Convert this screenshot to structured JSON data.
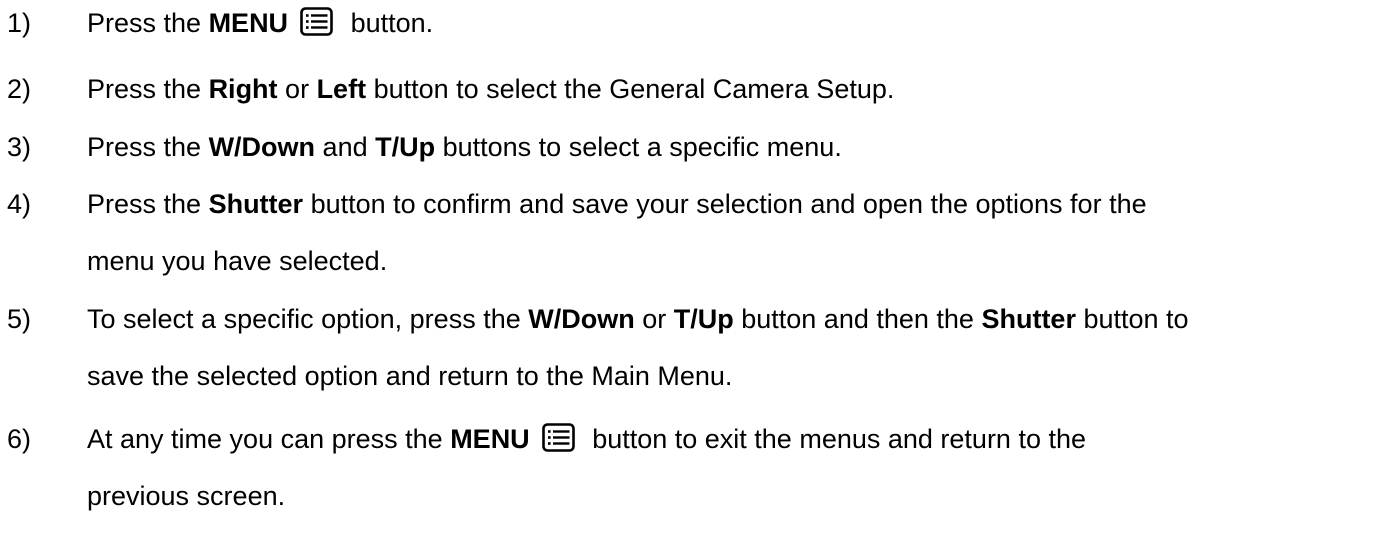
{
  "steps": [
    {
      "num": "1)",
      "parts": {
        "a": "Press the ",
        "b": "MENU",
        "c": " button."
      }
    },
    {
      "num": "2)",
      "parts": {
        "a": "Press the ",
        "b": "Right",
        "c": " or ",
        "d": "Left",
        "e": " button to select the General Camera Setup."
      }
    },
    {
      "num": "3)",
      "parts": {
        "a": "Press the ",
        "b": "W/Down",
        "c": " and ",
        "d": "T/Up",
        "e": " buttons to select a specific menu."
      }
    },
    {
      "num": "4)",
      "parts": {
        "a": "Press the ",
        "b": "Shutter",
        "c": " button to confirm and save your selection and open the options for the",
        "d": "menu you have selected."
      }
    },
    {
      "num": "5)",
      "parts": {
        "a": "To select a specific option, press the ",
        "b": "W/Down",
        "c": " or ",
        "d": "T/Up",
        "e": " button and then the ",
        "f": "Shutter",
        "g": " button to",
        "h": "save the selected option and return to the Main Menu."
      }
    },
    {
      "num": "6)",
      "parts": {
        "a": "At any time you can press the ",
        "b": "MENU",
        "c": " button to exit the menus and return to the",
        "d": "previous screen."
      }
    }
  ],
  "icons": {
    "menu": "menu-list-icon"
  }
}
